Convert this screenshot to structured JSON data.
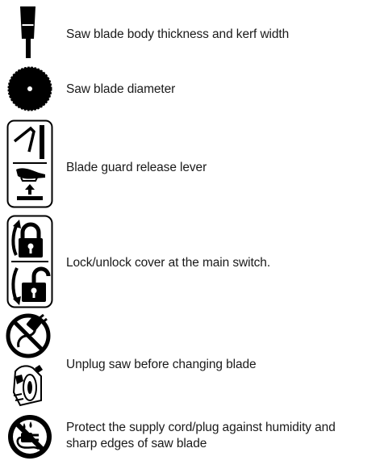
{
  "symbols": [
    {
      "icon": "blade-thickness-kerf-icon",
      "label": "Saw blade body thickness and kerf width"
    },
    {
      "icon": "blade-diameter-icon",
      "label": "Saw blade diameter"
    },
    {
      "icon": "blade-guard-release-lever-icon",
      "label": "Blade guard release lever"
    },
    {
      "icon": "lock-unlock-icon",
      "label": "Lock/unlock cover at the main switch."
    },
    {
      "icon": "unplug-before-blade-change-icon",
      "label": "Unplug saw before changing blade"
    },
    {
      "icon": "protect-cord-icon",
      "label": "Protect the supply cord/plug against humidity and",
      "label_line2": "sharp edges of saw blade"
    }
  ]
}
